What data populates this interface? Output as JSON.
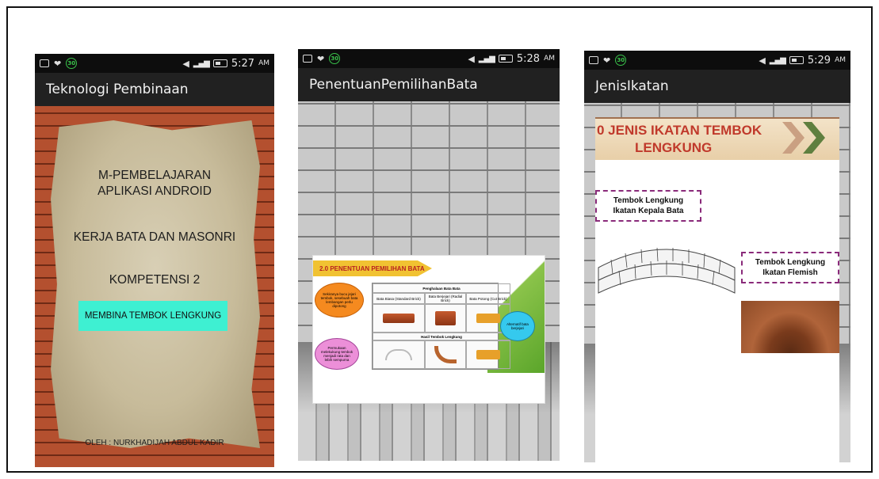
{
  "screens": [
    {
      "status": {
        "time": "5:27",
        "ampm": "AM",
        "net": "3G",
        "badge": "30"
      },
      "title": "Teknologi Pembinaan",
      "lines": {
        "heading_1": "M-PEMBELAJARAN",
        "heading_2": "APLIKASI ANDROID",
        "subject": "KERJA BATA DAN MASONRI",
        "competency": "KOMPETENSI 2"
      },
      "button_label": "MEMBINA TEMBOK LENGKUNG",
      "author": "OLEH : NURKHADIJAH ABDUL KADIR"
    },
    {
      "status": {
        "time": "5:28",
        "ampm": "AM",
        "net": "3G",
        "badge": "30"
      },
      "title": "PenentuanPemilihanBata",
      "slide": {
        "banner": "2.0 PENENTUAN PEMILIHAN BATA",
        "table_title": "Penghalaan Bata Bata",
        "col1": "Bata Biasa (Standard Brick)",
        "col2": "Bata Berjejari (Radial Brick)",
        "col3": "Bata Potong (Cut Brick)",
        "row2_title": "Hasil Tembok Lengkung",
        "note_orange": "Sekiranya bucu jejari tembok, sesebuah bata lembangan perlu dipotong",
        "note_pink": "Permukaan melekukung tembok menjadi rata dan lebih sempurna",
        "note_cyan": "Alternatif bata berjejari"
      }
    },
    {
      "status": {
        "time": "5:29",
        "ampm": "AM",
        "net": "3G",
        "badge": "30"
      },
      "title": "JenisIkatan",
      "slide": {
        "banner_line1": "0 JENIS IKATAN TEMBOK",
        "banner_line2": "LENGKUNG",
        "label_1a": "Tembok Lengkung",
        "label_1b": "Ikatan Kepala Bata",
        "label_2a": "Tembok Lengkung",
        "label_2b": "Ikatan Flemish"
      }
    }
  ],
  "colors": {
    "titlebar": "#212121",
    "statusbar": "#0d0d0d",
    "button": "#3ef0d2",
    "banner_red": "#c0392b",
    "label_border": "#8a2a7a"
  }
}
